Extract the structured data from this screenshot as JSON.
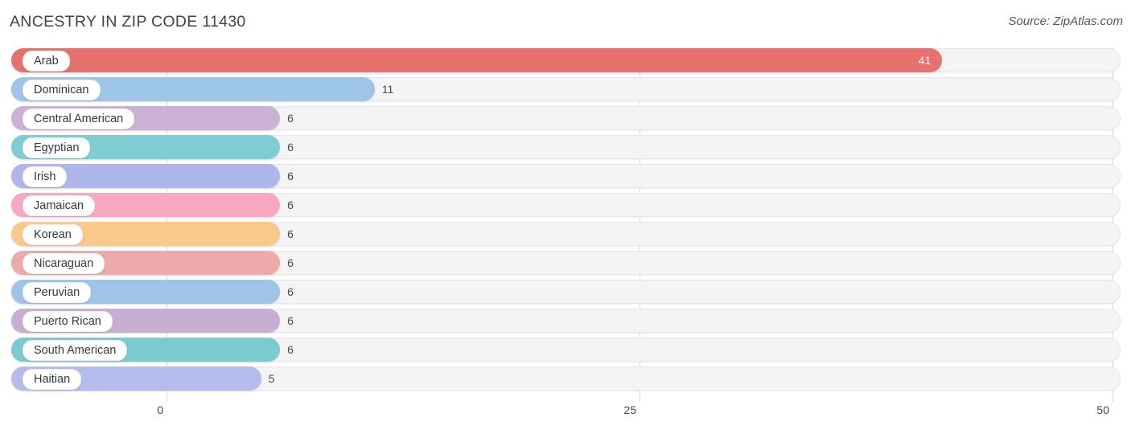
{
  "header": {
    "title": "ANCESTRY IN ZIP CODE 11430",
    "source": "Source: ZipAtlas.com"
  },
  "chart_data": {
    "type": "bar",
    "orientation": "horizontal",
    "title": "ANCESTRY IN ZIP CODE 11430",
    "subtitle": "",
    "xlabel": "",
    "ylabel": "",
    "xlim": [
      0,
      50
    ],
    "ticks": [
      "0",
      "25",
      "50"
    ],
    "tick_values": [
      0,
      25,
      50
    ],
    "grid": true,
    "legend": "none",
    "categories": [
      "Arab",
      "Dominican",
      "Central American",
      "Egyptian",
      "Irish",
      "Jamaican",
      "Korean",
      "Nicaraguan",
      "Peruvian",
      "Puerto Rican",
      "South American",
      "Haitian"
    ],
    "values": [
      41,
      11,
      6,
      6,
      6,
      6,
      6,
      6,
      6,
      6,
      6,
      5
    ],
    "value_labels": [
      "41",
      "11",
      "6",
      "6",
      "6",
      "6",
      "6",
      "6",
      "6",
      "6",
      "6",
      "5"
    ],
    "colors": [
      "#e7716d",
      "#9ec4e8",
      "#cbb2d4",
      "#7fccd2",
      "#aeb6ea",
      "#f9a8c3",
      "#fac88b",
      "#eda9ab",
      "#9ec4e8",
      "#c9aed3",
      "#79cbcf",
      "#b4bcee"
    ]
  }
}
